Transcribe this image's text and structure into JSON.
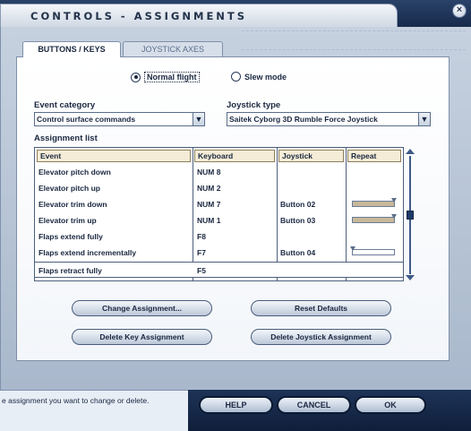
{
  "window": {
    "title": "CONTROLS - ASSIGNMENTS",
    "close_label": "×"
  },
  "tabs": [
    {
      "label": "BUTTONS / KEYS"
    },
    {
      "label": "JOYSTICK AXES"
    }
  ],
  "mode": {
    "normal_label": "Normal flight",
    "slew_label": "Slew mode",
    "selected": "Normal flight"
  },
  "event_category": {
    "label": "Event category",
    "value": "Control surface commands"
  },
  "joystick_type": {
    "label": "Joystick type",
    "value": "Saitek Cyborg 3D Rumble Force Joystick"
  },
  "assignment_list": {
    "label": "Assignment list",
    "columns": [
      "Event",
      "Keyboard",
      "Joystick",
      "Repeat"
    ],
    "rows": [
      {
        "event": "Elevator pitch down",
        "keyboard": "NUM 8",
        "joystick": "",
        "repeat": null
      },
      {
        "event": "Elevator pitch up",
        "keyboard": "NUM 2",
        "joystick": "",
        "repeat": null
      },
      {
        "event": "Elevator trim down",
        "keyboard": "NUM 7",
        "joystick": "Button 02",
        "repeat": 1.0
      },
      {
        "event": "Elevator trim up",
        "keyboard": "NUM 1",
        "joystick": "Button 03",
        "repeat": 1.0
      },
      {
        "event": "Flaps extend fully",
        "keyboard": "F8",
        "joystick": "",
        "repeat": null
      },
      {
        "event": "Flaps extend incrementally",
        "keyboard": "F7",
        "joystick": "Button 04",
        "repeat": 0.0
      },
      {
        "event": "Flaps retract fully",
        "keyboard": "F5",
        "joystick": "",
        "repeat": null
      }
    ],
    "selected_row": "Flaps retract fully",
    "scroll_position": 0.5
  },
  "buttons": {
    "change_assignment": "Change Assignment...",
    "reset_defaults": "Reset Defaults",
    "delete_key": "Delete Key Assignment",
    "delete_joystick": "Delete Joystick Assignment"
  },
  "status": {
    "text": "e assignment you want to change or delete."
  },
  "footer": {
    "help": "HELP",
    "cancel": "CANCEL",
    "ok": "OK"
  }
}
